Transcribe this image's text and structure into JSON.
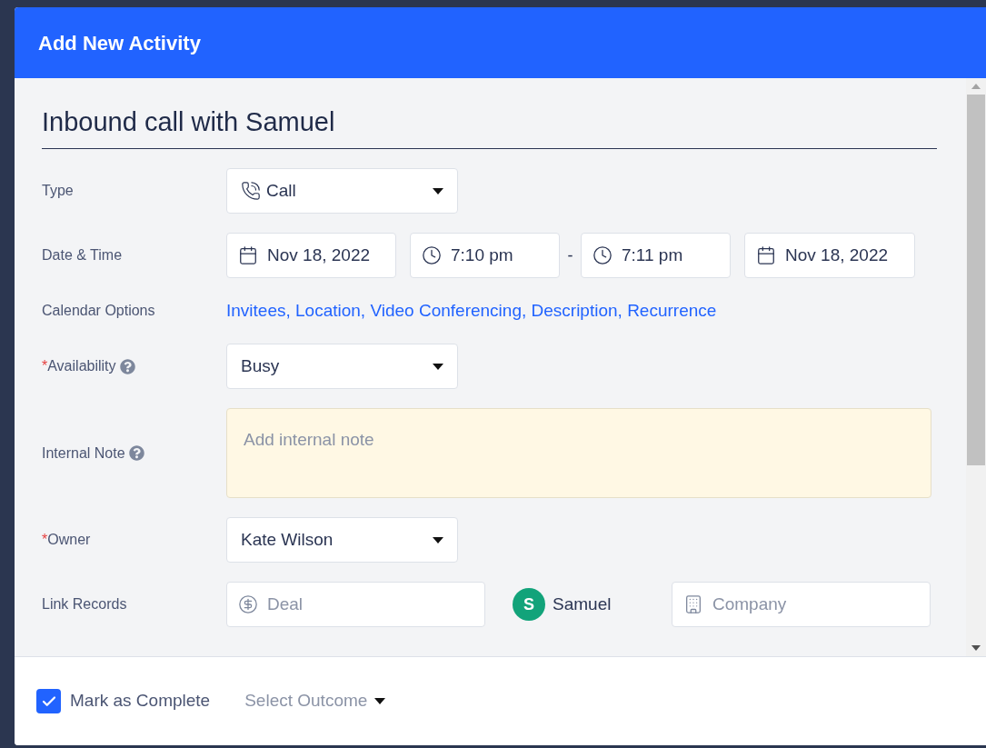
{
  "dialog": {
    "title": "Add New Activity"
  },
  "subject": {
    "value": "Inbound call with Samuel"
  },
  "fields": [
    {
      "kind": "select",
      "label": "Type",
      "value": "Call"
    },
    {
      "kind": "datetime",
      "label": "Date & Time",
      "start_date": "Nov 18, 2022",
      "start_time": "7:10 pm",
      "separator": "-",
      "end_time": "7:11 pm",
      "end_date": "Nov 18, 2022"
    },
    {
      "kind": "links",
      "label": "Calendar Options",
      "text": "Invitees, Location, Video Conferencing, Description, Recurrence"
    },
    {
      "kind": "select",
      "label": "Availability",
      "required_mark": "*",
      "help": true,
      "value": "Busy"
    },
    {
      "kind": "textarea",
      "label": "Internal Note",
      "help": true,
      "placeholder": "Add internal note"
    },
    {
      "kind": "select",
      "label": "Owner",
      "required_mark": "*",
      "value": "Kate Wilson"
    },
    {
      "kind": "records",
      "label": "Link Records",
      "deal_placeholder": "Deal",
      "contact": {
        "initial": "S",
        "name": "Samuel",
        "color": "#12a37a"
      },
      "company_placeholder": "Company"
    }
  ],
  "footer": {
    "complete": {
      "label": "Mark as Complete",
      "checked": true
    },
    "outcome": {
      "placeholder": "Select Outcome"
    }
  }
}
